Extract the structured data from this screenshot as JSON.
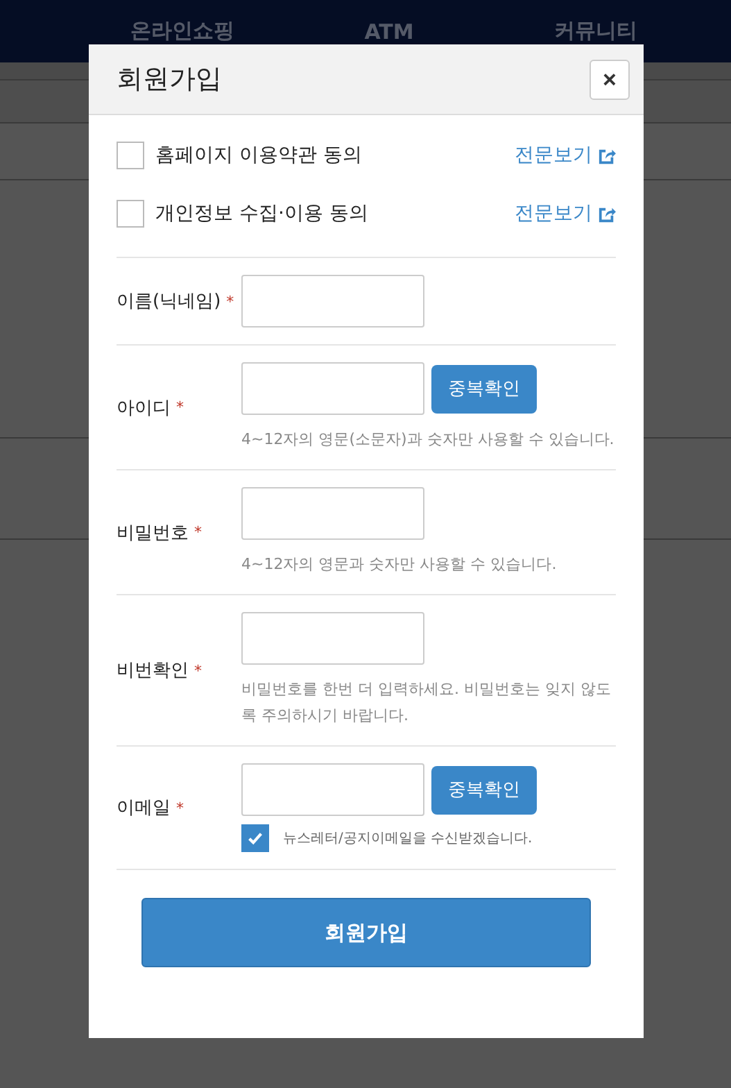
{
  "nav": {
    "items": [
      "온라인쇼핑",
      "ATM",
      "커뮤니티"
    ]
  },
  "modal": {
    "title": "회원가입",
    "close": "×",
    "agreements": [
      {
        "label": "홈페이지 이용약관 동의",
        "checked": false,
        "link": "전문보기"
      },
      {
        "label": "개인정보 수집·이용 동의",
        "checked": false,
        "link": "전문보기"
      }
    ],
    "fields": [
      {
        "label": "이름(닉네임)",
        "required_mark": "*"
      },
      {
        "label": "아이디",
        "required_mark": "*",
        "button": "중복확인",
        "help": "4~12자의 영문(소문자)과 숫자만 사용할 수 있습니다."
      },
      {
        "label": "비밀번호",
        "required_mark": "*",
        "help": "4~12자의 영문과 숫자만 사용할 수 있습니다."
      },
      {
        "label": "비번확인",
        "required_mark": "*",
        "help": "비밀번호를 한번 더 입력하세요. 비밀번호는 잊지 않도록 주의하시기 바랍니다."
      },
      {
        "label": "이메일",
        "required_mark": "*",
        "button": "중복확인",
        "option": {
          "label": "뉴스레터/공지이메일을 수신받겠습니다.",
          "checked": true
        }
      }
    ],
    "submit": "회원가입"
  }
}
